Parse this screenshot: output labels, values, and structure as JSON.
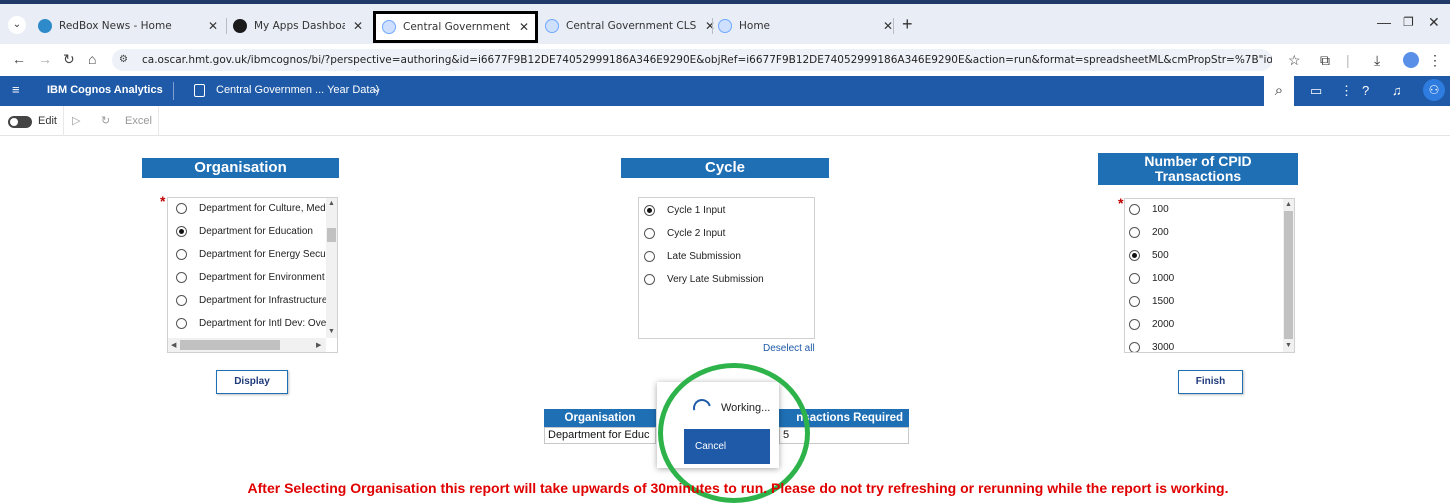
{
  "browser": {
    "tabs": [
      {
        "title": "RedBox News - Home",
        "color": "#2f8ac9"
      },
      {
        "title": "My Apps Dashboard | oscar",
        "color": "#1a1a1a"
      },
      {
        "title": "Central Government – CPID tra",
        "color": "#6fa8ff"
      },
      {
        "title": "Central Government CLS – CPID",
        "color": "#6fa8ff"
      },
      {
        "title": "Home",
        "color": "#6fa8ff"
      }
    ],
    "url": "ca.oscar.hmt.gov.uk/ibmcognos/bi/?perspective=authoring&id=i6677F9B12DE74052999186A346E9290E&objRef=i6677F9B12DE74052999186A346E9290E&action=run&format=spreadsheetML&cmPropStr=%7B\"id\"%3A\"i6677F9B12DE74052999186A346E9290E\"%..."
  },
  "cognos": {
    "product": "IBM Cognos Analytics",
    "report_title": "Central Governmen ... Year Data)"
  },
  "toolbar": {
    "edit_label": "Edit",
    "excel_label": "Excel"
  },
  "organisation": {
    "header": "Organisation",
    "options": [
      "Department for Culture, Media",
      "Department for Education",
      "Department for Energy Securi",
      "Department for Environment F",
      "Department for Infrastructure",
      "Department for Intl Dev: Over"
    ],
    "selected": 1,
    "button": "Display"
  },
  "cycle": {
    "header": "Cycle",
    "options": [
      "Cycle 1 Input",
      "Cycle 2 Input",
      "Late Submission",
      "Very Late Submission"
    ],
    "selected": 0,
    "deselect": "Deselect all"
  },
  "transactions": {
    "header_line1": "Number of CPID",
    "header_line2": "Transactions",
    "options": [
      "100",
      "200",
      "500",
      "1000",
      "1500",
      "2000",
      "3000"
    ],
    "selected": 2,
    "button": "Finish"
  },
  "results": {
    "col1_header": "Organisation",
    "col1_value": "Department for Educ",
    "col2_header": "nsactions Required",
    "col2_value": "5"
  },
  "working": {
    "text": "Working...",
    "cancel": "Cancel"
  },
  "warning": "After Selecting Organisation this report will take upwards of 30minutes to run. Please do not try refreshing or rerunning while the report is working."
}
